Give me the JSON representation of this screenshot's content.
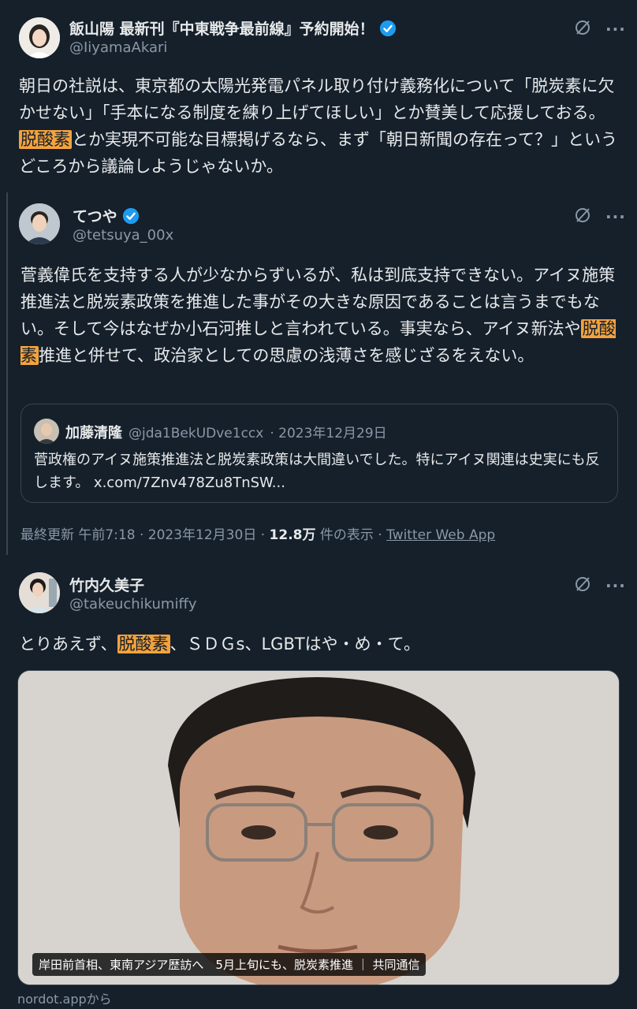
{
  "post1": {
    "display_name": "飯山陽 最新刊『中東戦争最前線』予約開始！",
    "handle": "@IiyamaAkari",
    "text_before": "朝日の社説は、東京都の太陽光発電パネル取り付け義務化について「脱炭素に欠かせない」「手本になる制度を練り上げてほしい」とか賛美して応援しておる。",
    "highlight": "脱酸素",
    "text_after": "とか実現不可能な目標掲げるなら、まず「朝日新聞の存在って？」というどころから議論しようじゃないか。"
  },
  "post2": {
    "display_name": "てつや",
    "handle": "@tetsuya_00x",
    "text_before": "菅義偉氏を支持する人が少なからずいるが、私は到底支持できない。アイヌ施策推進法と脱炭素政策を推進した事がその大きな原因であることは言うまでもない。そして今はなぜか小石河推しと言われている。事実なら、アイヌ新法や",
    "highlight": "脱酸素",
    "text_after": "推進と併せて、政治家としての思慮の浅薄さを感じざるをえない。",
    "quote": {
      "display_name": "加藤清隆",
      "handle": "@jda1BekUDve1ccx",
      "date": "· 2023年12月29日",
      "text": "菅政権のアイヌ施策推進法と脱炭素政策は大間違いでした。特にアイヌ関連は史実にも反します。 x.com/7Znv478Zu8TnSW..."
    },
    "meta_time": "最終更新 午前7:18 · 2023年12月30日 · ",
    "meta_views": "12.8万",
    "meta_views_label": " 件の表示 · ",
    "meta_source": "Twitter Web App"
  },
  "post3": {
    "display_name": "竹内久美子",
    "handle": "@takeuchikumiffy",
    "text_before": "とりあえず、",
    "highlight": "脱酸素",
    "text_after": "、ＳＤＧs、LGBTはや・め・て。",
    "media_caption": "岸田前首相、東南アジア歴訪へ　5月上旬にも、脱炭素推進 ｜ 共同通信",
    "link_domain": "nordot.appから"
  },
  "icons": {
    "grok": "grok-icon",
    "more": "more-icon",
    "verified": "verified-badge-icon"
  },
  "colors": {
    "background": "#15202b",
    "highlight": "#f4a23d",
    "verified": "#1d9bf0"
  }
}
